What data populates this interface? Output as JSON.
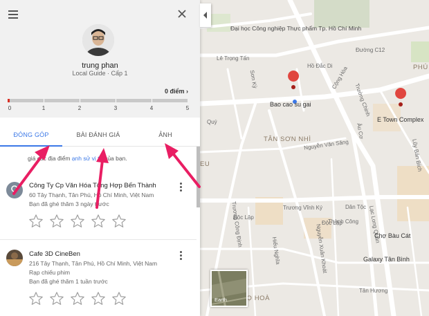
{
  "profile": {
    "name": "trung phan",
    "level": "Local Guide · Cấp 1",
    "points": "0 điểm ›",
    "progress_fraction": 0.005,
    "progress_ticks": [
      "0",
      "1",
      "2",
      "3",
      "4",
      "5"
    ]
  },
  "tabs": [
    {
      "label": "ĐÓNG GÓP",
      "active": true
    },
    {
      "label": "BÀI ĐÁNH GIÁ",
      "active": false
    },
    {
      "label": "ẢNH",
      "active": false
    }
  ],
  "hint": {
    "prefix": "giá các địa điểm ",
    "link": "ạnh sử vị trí",
    "suffix": " của bạn."
  },
  "contributions": [
    {
      "title": "Công Ty Cp Văn Hóa Tổng Hợp Bến Thành",
      "address": "60 Tây Thạnh, Tân Phú, Hồ Chí Minh, Việt Nam",
      "category": "",
      "visited": "Bạn đã ghé thăm 3 ngày trước",
      "stars": 5,
      "rating": 0
    },
    {
      "title": "Cafe 3D CineBen",
      "address": "216 Tây Thạnh, Tân Phú, Hồ Chí Minh, Việt Nam",
      "category": "Rạp chiếu phim",
      "visited": "Bạn đã ghé thăm 1 tuần trước",
      "stars": 5,
      "rating": 0
    }
  ],
  "map": {
    "poi_university": "Đại học Công nghiệp Thực phẩm Tp. Hồ Chí Minh",
    "poi_bao_cao_su": "Bao cao su gai",
    "poi_etown": "E Town Complex",
    "district_tan_son_nhi": "TÂN SƠN NHÌ",
    "street_le_trong_tan": "Lê Trọng Tấn",
    "street_ho_dac_di": "Hồ Đắc Di",
    "street_duong_c12": "Đường C12",
    "street_cong_hoa": "Cộng Hòa",
    "street_son_ky": "Sơn Kỳ",
    "street_truong_chinh": "Trường Chinh",
    "street_au_co": "Âu Cơ",
    "street_luy_ban_bich": "Lũy Bán Bích",
    "street_nguyen_van_sang": "Nguyễn Văn Săng",
    "street_truong_vinh_ky": "Trương Vĩnh Ký",
    "street_dan_toc": "Dân Tộc",
    "street_doc_lap_a": "Độc Lập",
    "street_doc_lap_b": "Độc Lập",
    "street_thanh_cong": "Thành Công",
    "street_lac_long_quan": "Lạc Long Quân",
    "street_cho_bau_cat": "Chợ Bàu Cát",
    "street_galaxy": "Galaxy Tân Bình",
    "street_tan_huong": "Tân Hương",
    "street_ho_hoa": "HỌ HOÀ",
    "street_phu": "PHÚ",
    "street_eu": "EU",
    "street_truong_cong_dinh": "Trương Công Định",
    "street_nguyen_xuan_khoat": "Nguyễn Xuân Khoát",
    "street_hieu_nghia": "Hiếu Nghĩa",
    "street_quy": "Quý",
    "earth": "Earth"
  },
  "colors": {
    "accent": "#3b78e7",
    "progress": "#d93025",
    "arrow": "#e91e63",
    "marker": "#e0463f",
    "district": "#f0d9b8"
  }
}
